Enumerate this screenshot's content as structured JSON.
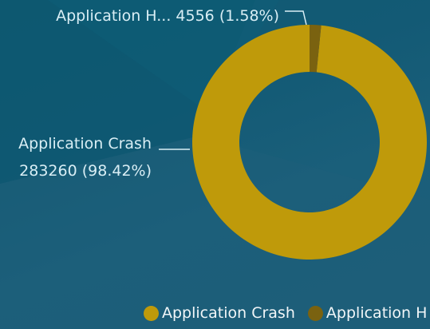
{
  "chart_data": {
    "type": "pie",
    "donut": true,
    "categories": [
      "Application Crash",
      "Application H..."
    ],
    "values": [
      283260,
      4556
    ],
    "percents": [
      "98.42%",
      "1.58%"
    ],
    "colors": [
      "#bf9a0a",
      "#7a6210"
    ],
    "labels": {
      "crash_name": "Application Crash",
      "crash_value": "283260 (98.42%)",
      "hang": "Application H... 4556 (1.58%)"
    },
    "legend": {
      "position": "bottom",
      "items": [
        "Application Crash",
        "Application H"
      ]
    }
  }
}
